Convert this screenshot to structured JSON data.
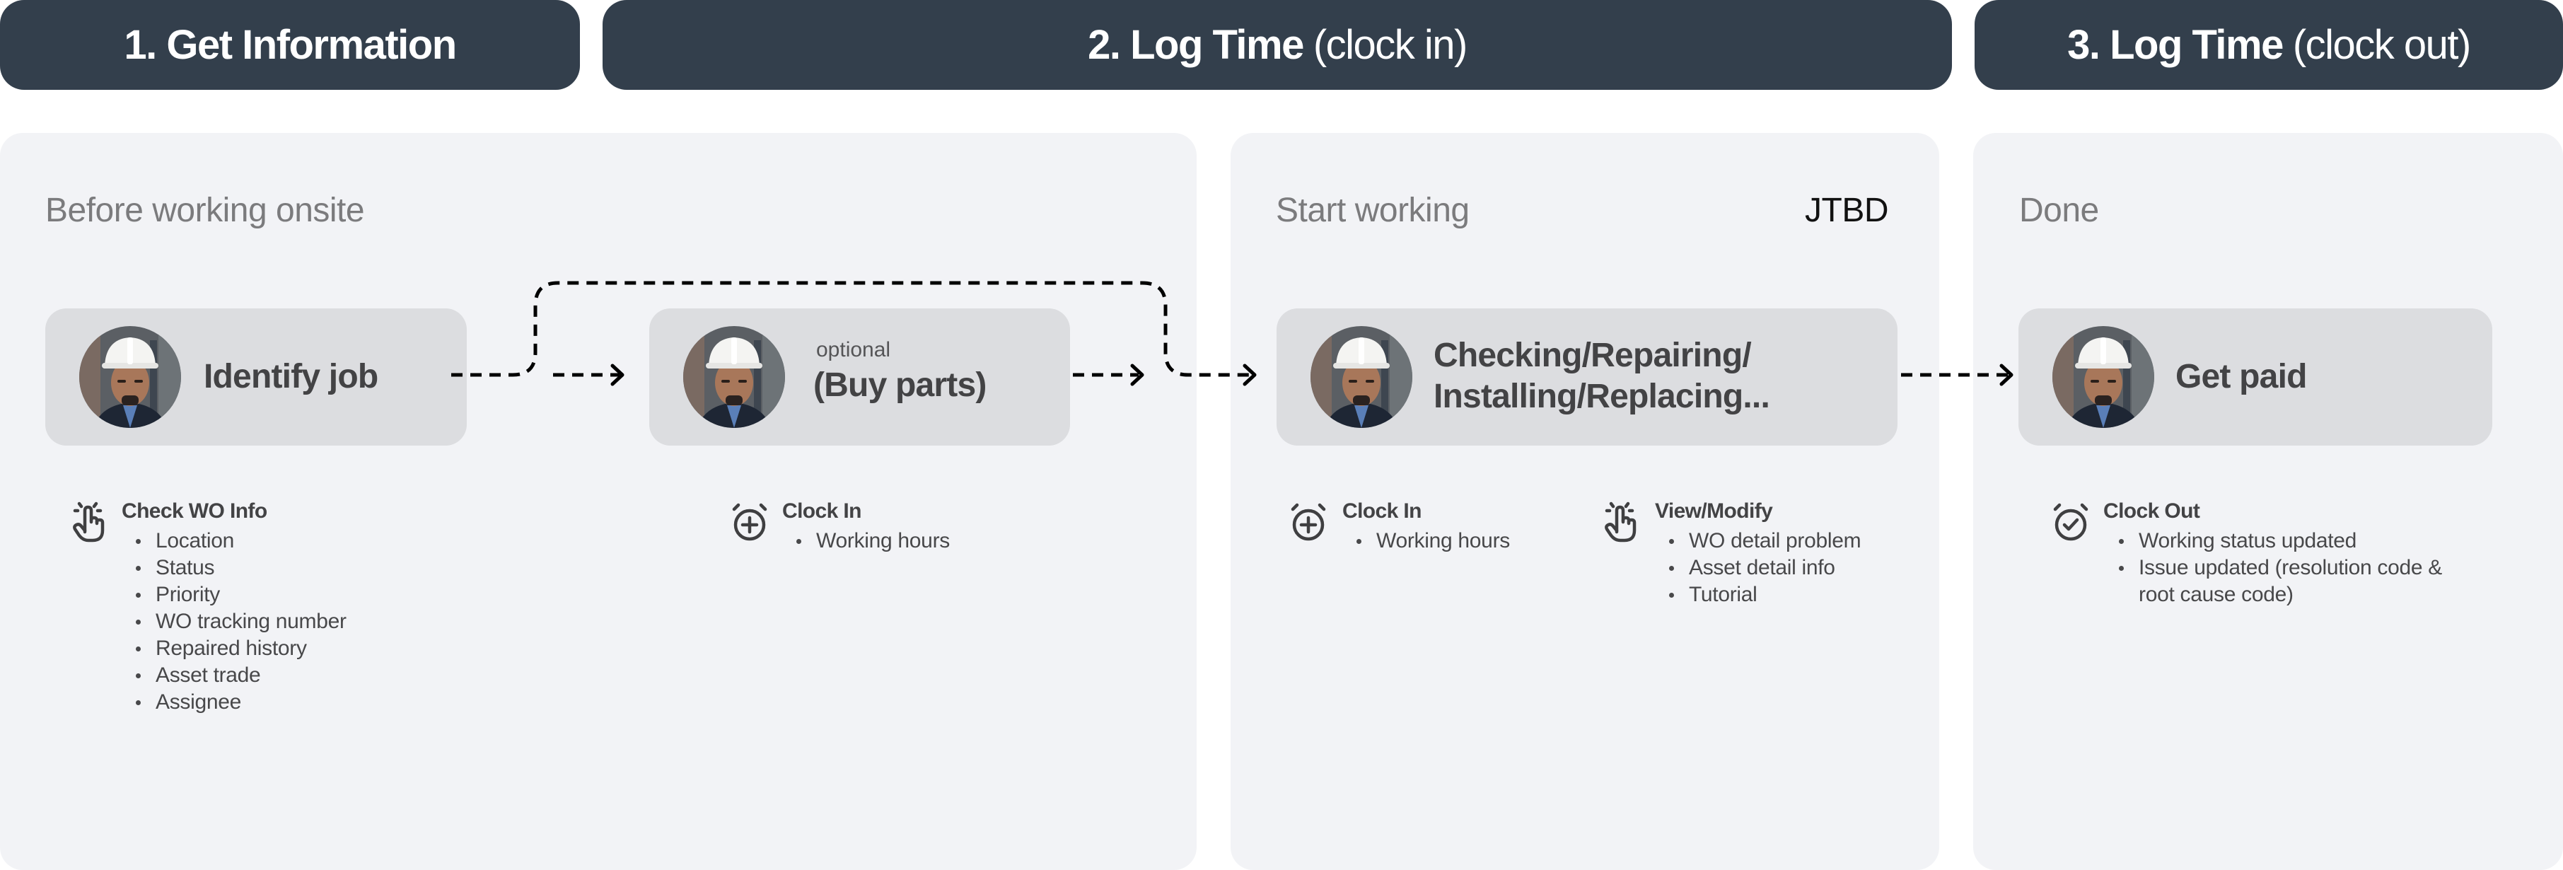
{
  "phases": [
    {
      "number_title": "1. Get Information",
      "subtitle": ""
    },
    {
      "number_title": "2. Log Time",
      "subtitle": "(clock in)"
    },
    {
      "number_title": "3. Log Time",
      "subtitle": "(clock out)"
    }
  ],
  "panels": [
    {
      "label": "Before working onsite"
    },
    {
      "label": "Start working",
      "tag": "JTBD"
    },
    {
      "label": "Done"
    }
  ],
  "cards": [
    {
      "title": "Identify job",
      "avatar": "worker-photo"
    },
    {
      "optional_label": "optional",
      "title": "(Buy parts)",
      "avatar": "worker-photo"
    },
    {
      "title_line1": "Checking/Repairing/",
      "title_line2": "Installing/Replacing...",
      "avatar": "worker-photo"
    },
    {
      "title": "Get paid",
      "avatar": "worker-photo"
    }
  ],
  "actions": [
    {
      "icon": "tap-hand-icon",
      "title": "Check WO Info",
      "items": [
        "Location",
        "Status",
        "Priority",
        "WO tracking number",
        "Repaired history",
        "Asset trade",
        "Assignee"
      ]
    },
    {
      "icon": "alarm-clock-plus-icon",
      "title": "Clock In",
      "items": [
        "Working hours"
      ]
    },
    {
      "icon": "alarm-clock-plus-icon",
      "title": "Clock In",
      "items": [
        "Working hours"
      ]
    },
    {
      "icon": "tap-hand-icon",
      "title": "View/Modify",
      "items": [
        "WO detail problem",
        "Asset detail info",
        "Tutorial"
      ]
    },
    {
      "icon": "alarm-clock-check-icon",
      "title": "Clock Out",
      "items": [
        "Working status updated",
        "Issue updated (resolution code & root cause code)"
      ]
    }
  ],
  "colors": {
    "header_bg": "#333f4c",
    "panel_bg": "#f2f3f6",
    "card_bg": "#dcdde0",
    "text_dark": "#434345",
    "label_gray": "#7b7b7d"
  }
}
